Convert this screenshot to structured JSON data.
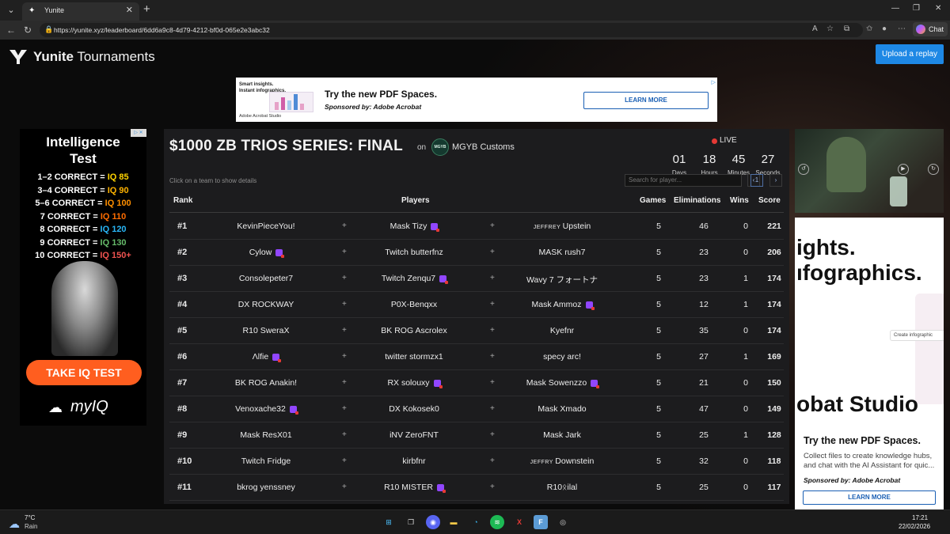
{
  "browser": {
    "tab_title": "Yunite",
    "url": "https://yunite.xyz/leaderboard/6dd6a9c8-4d79-4212-bf0d-065e2e3abc32",
    "chat_label": "Chat"
  },
  "site": {
    "logo_bold": "Yunite",
    "logo_rest": " Tournaments",
    "upload_label": "Upload a replay"
  },
  "banner_ad": {
    "left_line1": "Smart insights.",
    "left_line2": "Instant infographics.",
    "left_brand": "Adobe Acrobat Studio",
    "title": "Try the new PDF Spaces.",
    "sponsor": "Sponsored by: Adobe Acrobat",
    "button": "LEARN MORE"
  },
  "left_ad": {
    "title_line1": "Intelligence",
    "title_line2": "Test",
    "rows": [
      {
        "left": "1–2 CORRECT = ",
        "iq": "IQ 85",
        "color": "#ffd400"
      },
      {
        "left": "3–4 CORRECT = ",
        "iq": "IQ 90",
        "color": "#ffb300"
      },
      {
        "left": "5–6 CORRECT = ",
        "iq": "IQ 100",
        "color": "#ff8f00"
      },
      {
        "left": "7 CORRECT = ",
        "iq": "IQ 110",
        "color": "#ff6d00"
      },
      {
        "left": "8 CORRECT = ",
        "iq": "IQ 120",
        "color": "#29b6f6"
      },
      {
        "left": "9 CORRECT = ",
        "iq": "IQ 130",
        "color": "#66bb6a"
      },
      {
        "left": "10 CORRECT = ",
        "iq": "IQ 150+",
        "color": "#ef5350"
      }
    ],
    "cta": "TAKE IQ TEST",
    "brand": "myIQ"
  },
  "board": {
    "title": "$1000 ZB TRIOS SERIES: FINAL",
    "on": "on",
    "org_logo_text": "MGYB",
    "org": "MGYB Customs",
    "live": "LIVE",
    "countdown": [
      {
        "value": "01",
        "label": "Days"
      },
      {
        "value": "18",
        "label": "Hours"
      },
      {
        "value": "45",
        "label": "Minutes"
      },
      {
        "value": "27",
        "label": "Seconds"
      }
    ],
    "hint": "Click on a team to show details",
    "search_placeholder": "Search for player...",
    "page": "1",
    "headers": {
      "rank": "Rank",
      "players": "Players",
      "games": "Games",
      "elims": "Eliminations",
      "wins": "Wins",
      "score": "Score"
    },
    "plus": "+",
    "rows": [
      {
        "rank": "#1",
        "p1": "KevinPieceYou!",
        "p2": "Mask Tizy",
        "p3": "Upstein",
        "p3pre": "JEFFREY ",
        "t1": false,
        "t2": true,
        "t3": false,
        "games": "5",
        "elims": "46",
        "wins": "0",
        "score": "221"
      },
      {
        "rank": "#2",
        "p1": "Cylow",
        "p2": "Twitch butterfnz",
        "p3": "MASK rush7",
        "p3pre": "",
        "t1": true,
        "t2": false,
        "t3": false,
        "games": "5",
        "elims": "23",
        "wins": "0",
        "score": "206"
      },
      {
        "rank": "#3",
        "p1": "Consolepeter7",
        "p2": "Twitch Zenqu7",
        "p3": "Wavy 7 フォートナ",
        "p3pre": "",
        "t1": false,
        "t2": true,
        "t3": false,
        "games": "5",
        "elims": "23",
        "wins": "1",
        "score": "174"
      },
      {
        "rank": "#4",
        "p1": "DX ROCKWAY",
        "p2": "P0X-Benqxx",
        "p3": "Mask Ammoz",
        "p3pre": "",
        "t1": false,
        "t2": false,
        "t3": true,
        "games": "5",
        "elims": "12",
        "wins": "1",
        "score": "174"
      },
      {
        "rank": "#5",
        "p1": "R10 SweraX",
        "p2": "BK ROG Ascrolex",
        "p3": "Kyefnr",
        "p3pre": "",
        "t1": false,
        "t2": false,
        "t3": false,
        "games": "5",
        "elims": "35",
        "wins": "0",
        "score": "174"
      },
      {
        "rank": "#6",
        "p1": "Λlfie",
        "p2": "twitter stormzx1",
        "p3": "specy arc!",
        "p3pre": "",
        "t1": true,
        "t2": false,
        "t3": false,
        "games": "5",
        "elims": "27",
        "wins": "1",
        "score": "169"
      },
      {
        "rank": "#7",
        "p1": "BK ROG Anakin!",
        "p2": "RX solouxy",
        "p3": "Mask Sowenzzo",
        "p3pre": "",
        "t1": false,
        "t2": true,
        "t3": true,
        "games": "5",
        "elims": "21",
        "wins": "0",
        "score": "150"
      },
      {
        "rank": "#8",
        "p1": "Venoxache32",
        "p2": "DX Kokosek0",
        "p3": "Mask Xmado",
        "p3pre": "",
        "t1": true,
        "t2": false,
        "t3": false,
        "games": "5",
        "elims": "47",
        "wins": "0",
        "score": "149"
      },
      {
        "rank": "#9",
        "p1": "Mask ResX01",
        "p2": "iNV ZeroFNT",
        "p3": "Mask Jark",
        "p3pre": "",
        "t1": false,
        "t2": false,
        "t3": false,
        "games": "5",
        "elims": "25",
        "wins": "1",
        "score": "128"
      },
      {
        "rank": "#10",
        "p1": "Twitch Fridge",
        "p2": "kirbfnr",
        "p3": "Downstein",
        "p3pre": "JEFFRY ",
        "t1": false,
        "t2": false,
        "t3": false,
        "games": "5",
        "elims": "32",
        "wins": "0",
        "score": "118"
      },
      {
        "rank": "#11",
        "p1": "bkrog yenssney",
        "p2": "R10 MISTER",
        "p3": "R10ᛟilal",
        "p3pre": "",
        "t1": false,
        "t2": true,
        "t3": false,
        "games": "5",
        "elims": "25",
        "wins": "0",
        "score": "117"
      }
    ]
  },
  "right_ad": {
    "big_line1": "ights.",
    "big_line2": "ıfographics.",
    "pill": "Create infographic",
    "big_line3": "obat Studio",
    "title": "Try the new PDF Spaces.",
    "body": "Collect files to create knowledge hubs, and chat with the AI Assistant for quic...",
    "sponsor": "Sponsored by: Adobe Acrobat",
    "button": "LEARN MORE"
  },
  "taskbar": {
    "temp": "7°C",
    "condition": "Rain",
    "time": "17:21",
    "date": "22/02/2026"
  }
}
